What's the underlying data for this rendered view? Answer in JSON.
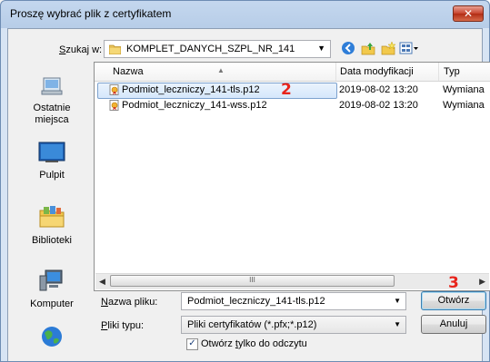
{
  "window": {
    "title": "Proszę wybrać plik z certyfikatem",
    "close_glyph": "✕"
  },
  "toolbar": {
    "look_in_label_pre": "",
    "look_in_label_u": "S",
    "look_in_label_post": "zukaj w:",
    "current_folder": "KOMPLET_DANYCH_SZPL_NR_141",
    "icons": [
      "back-icon",
      "up-folder-icon",
      "new-folder-icon",
      "view-menu-icon"
    ]
  },
  "places": [
    {
      "label": "Ostatnie miejsca",
      "icon": "recent-places-icon"
    },
    {
      "label": "Pulpit",
      "icon": "desktop-icon"
    },
    {
      "label": "Biblioteki",
      "icon": "libraries-icon"
    },
    {
      "label": "Komputer",
      "icon": "computer-icon"
    },
    {
      "label": "",
      "icon": "network-icon"
    }
  ],
  "columns": {
    "name": "Nazwa",
    "date": "Data modyfikacji",
    "type": "Typ"
  },
  "files": [
    {
      "name": "Podmiot_leczniczy_141-tls.p12",
      "date": "2019-08-02 13:20",
      "type": "Wymiana",
      "selected": true
    },
    {
      "name": "Podmiot_leczniczy_141-wss.p12",
      "date": "2019-08-02 13:20",
      "type": "Wymiana",
      "selected": false
    }
  ],
  "annotations": {
    "file_step": "2",
    "open_step": "3"
  },
  "filename": {
    "label_u": "N",
    "label_rest": "azwa pliku:",
    "value": "Podmiot_leczniczy_141-tls.p12"
  },
  "filetype": {
    "label_u": "P",
    "label_rest": "liki typu:",
    "value": "Pliki certyfikatów (*.pfx;*.p12)"
  },
  "buttons": {
    "open": "Otwórz",
    "cancel": "Anuluj"
  },
  "readonly": {
    "checked": true,
    "check_glyph": "✓",
    "label_pre": "Otwórz ",
    "label_u": "t",
    "label_post": "ylko do odczytu"
  },
  "scrollbar": {
    "thumb_grip": "III",
    "left_arrow": "◀",
    "right_arrow": "▶"
  }
}
